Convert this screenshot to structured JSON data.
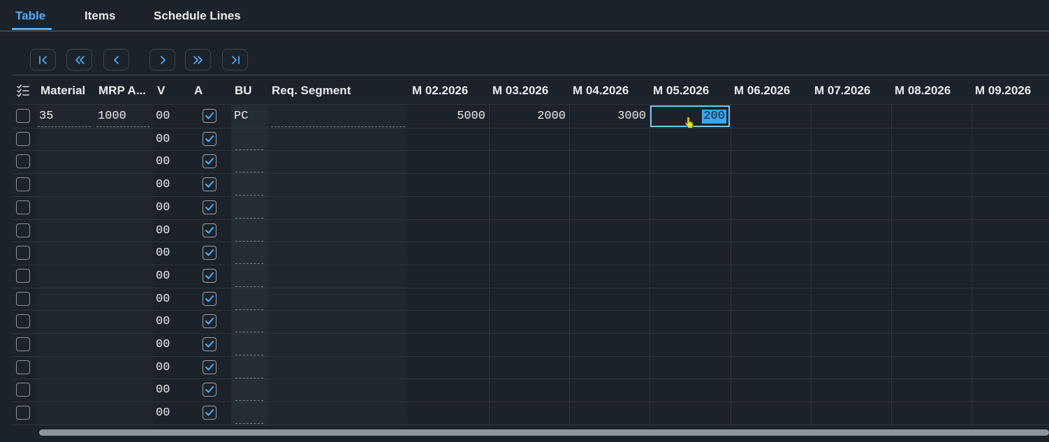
{
  "tabs": [
    {
      "label": "Table",
      "active": true
    },
    {
      "label": "Items",
      "active": false
    },
    {
      "label": "Schedule Lines",
      "active": false
    }
  ],
  "nav_buttons": [
    {
      "icon": "first-page-icon"
    },
    {
      "icon": "page-up-icon"
    },
    {
      "icon": "previous-icon"
    },
    {
      "icon": "next-icon"
    },
    {
      "icon": "page-down-icon"
    },
    {
      "icon": "last-page-icon"
    }
  ],
  "table": {
    "columns": [
      "Material",
      "MRP A...",
      "V",
      "A",
      "BU",
      "Req. Segment",
      "M 02.2026",
      "M 03.2026",
      "M 04.2026",
      "M 05.2026",
      "M 06.2026",
      "M 07.2026",
      "M 08.2026",
      "M 09.2026"
    ],
    "first_row": {
      "material": "35",
      "mrp_area": "1000",
      "v": "00",
      "bu": "PC",
      "m02": "5000",
      "m03": "2000",
      "m04": "3000",
      "m05_editing": "200"
    },
    "v_values": [
      "00",
      "00",
      "00",
      "00",
      "00",
      "00",
      "00",
      "00",
      "00",
      "00",
      "00",
      "00",
      "00",
      "00"
    ],
    "a_checked": [
      true,
      true,
      true,
      true,
      true,
      true,
      true,
      true,
      true,
      true,
      true,
      true,
      true,
      true
    ]
  },
  "colors": {
    "background": "#1c2229",
    "accent": "#4db1ff",
    "text": "#eaecee"
  }
}
